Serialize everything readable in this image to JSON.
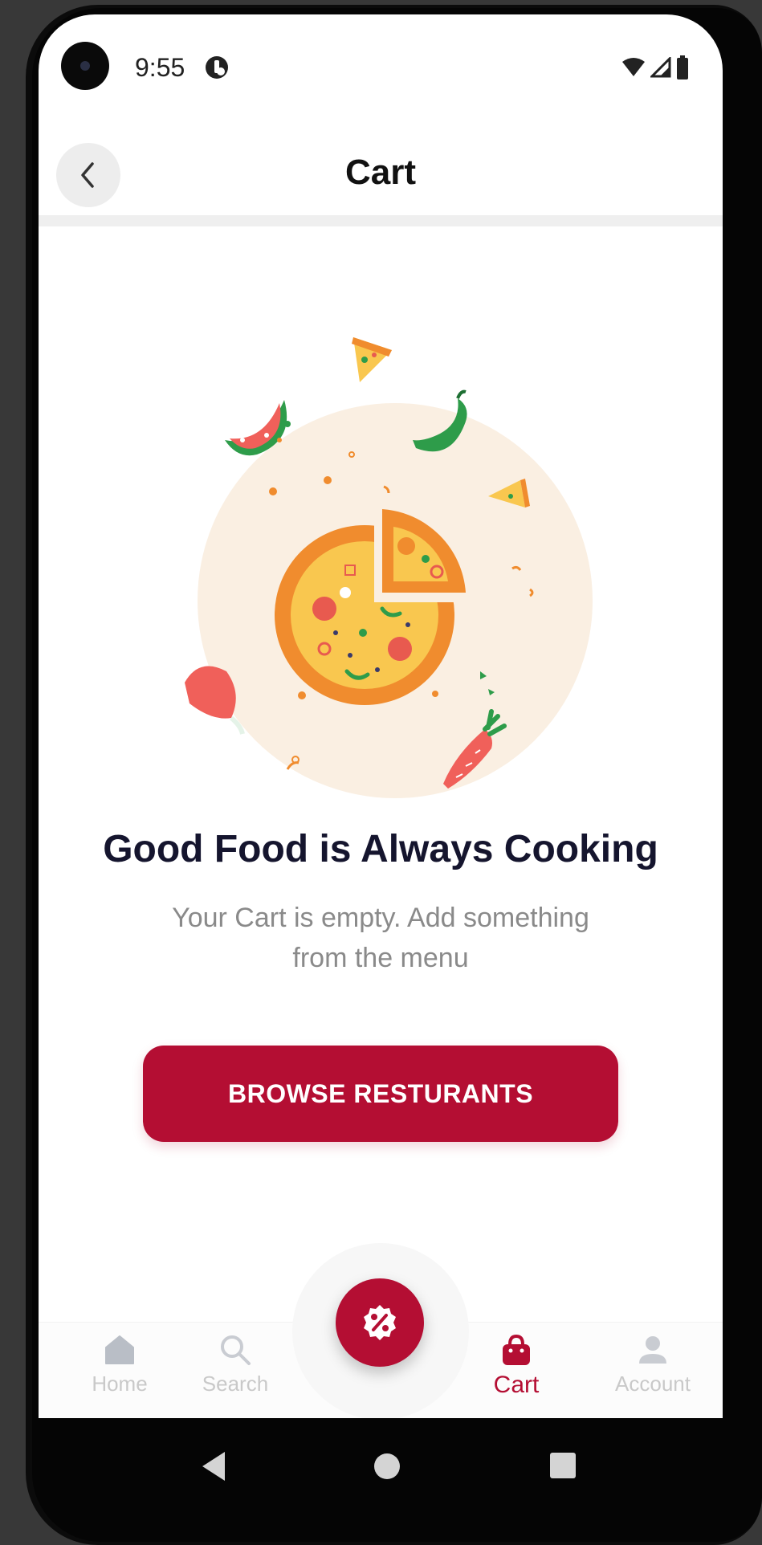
{
  "status_bar": {
    "time": "9:55"
  },
  "header": {
    "title": "Cart",
    "back_icon": "chevron-left-icon"
  },
  "empty_state": {
    "title": "Good Food is Always Cooking",
    "subtitle": "Your Cart is empty. Add something from the menu",
    "button_label": "BROWSE RESTURANTS"
  },
  "bottom_nav": {
    "items": [
      {
        "label": "Home",
        "icon": "home-icon",
        "active": false
      },
      {
        "label": "Search",
        "icon": "search-icon",
        "active": false
      },
      {
        "label": "Cart",
        "icon": "shopping-bag-icon",
        "active": true
      },
      {
        "label": "Account",
        "icon": "user-icon",
        "active": false
      }
    ],
    "fab_icon": "discount-icon"
  },
  "colors": {
    "primary": "#b40e33",
    "title_text": "#15152e",
    "subtitle_text": "#8a8a8a",
    "inactive_nav": "#c9c9c9",
    "illustration_bg": "#faefe2"
  }
}
